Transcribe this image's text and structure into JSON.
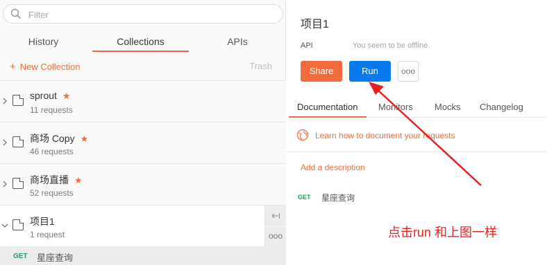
{
  "sidebar": {
    "search_placeholder": "Filter",
    "tabs": [
      {
        "label": "History"
      },
      {
        "label": "Collections"
      },
      {
        "label": "APIs"
      }
    ],
    "new_collection_label": "New Collection",
    "trash_label": "Trash",
    "collections": [
      {
        "name": "sprout",
        "count": "11 requests",
        "starred": true
      },
      {
        "name": "商场 Copy",
        "count": "46 requests",
        "starred": true
      },
      {
        "name": "商场直播",
        "count": "52 requests",
        "starred": true
      },
      {
        "name": "项目1",
        "count": "1 request",
        "starred": false
      }
    ],
    "open_request": {
      "method": "GET",
      "name": "星座查询"
    }
  },
  "detail": {
    "title": "项目1",
    "api_label": "API",
    "offline_text": "You seem to be offline.",
    "share_label": "Share",
    "run_label": "Run",
    "more_label": "ooo",
    "tabs": [
      {
        "label": "Documentation"
      },
      {
        "label": "Monitors"
      },
      {
        "label": "Mocks"
      },
      {
        "label": "Changelog"
      }
    ],
    "learn_text": "Learn how to document your requests",
    "add_description": "Add a description",
    "request": {
      "method": "GET",
      "name": "星座查询"
    }
  },
  "annotation": {
    "text": "点击run  和上图一样",
    "color": "#e62020"
  },
  "colors": {
    "accent": "#f26b3a",
    "run_blue": "#097bed",
    "get_green": "#1c9c5e"
  }
}
